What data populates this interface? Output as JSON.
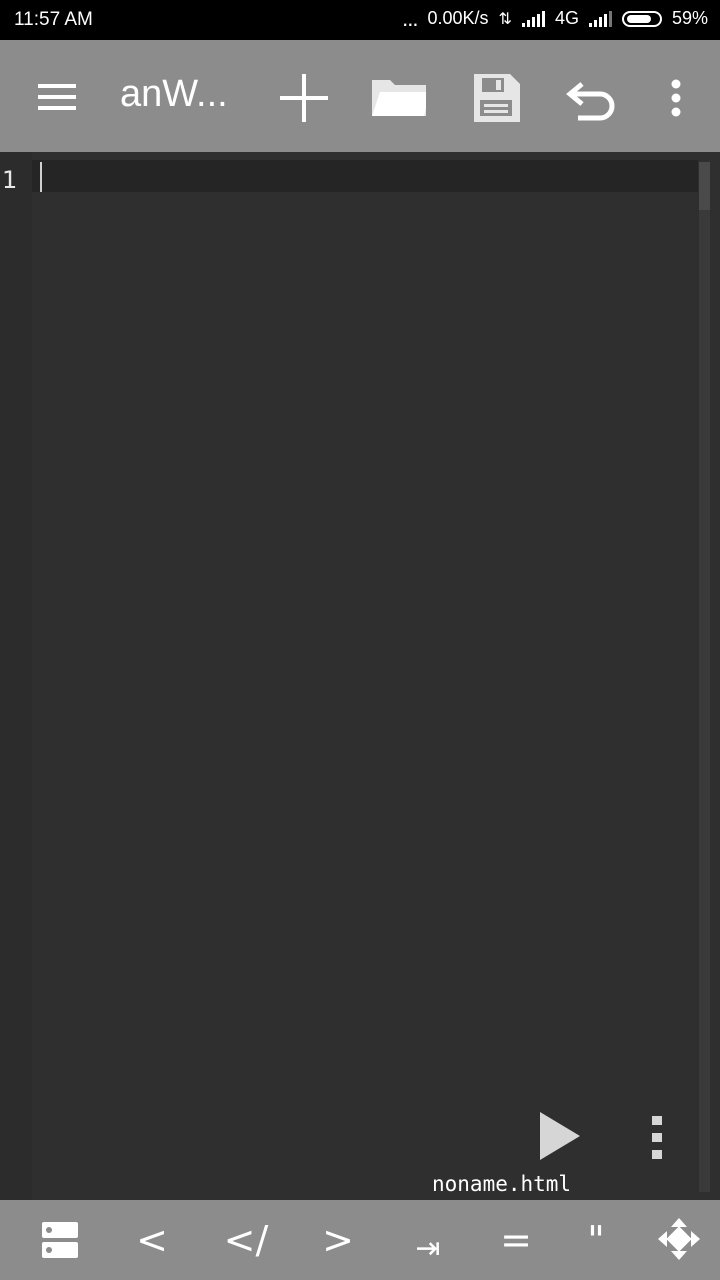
{
  "status_bar": {
    "time": "11:57 AM",
    "dots": "...",
    "speed": "0.00K/s",
    "network": "4G",
    "battery": "59%"
  },
  "toolbar": {
    "title": "anW...",
    "icons": [
      "menu-icon",
      "add-icon",
      "folder-icon",
      "save-icon",
      "undo-icon",
      "more-vert-icon"
    ]
  },
  "editor": {
    "line_numbers": [
      "1"
    ],
    "filename": "noname.html"
  },
  "bottom_bar": {
    "keys": [
      "<",
      "</",
      ">",
      "⇥",
      "=",
      "\""
    ],
    "icons": [
      "storage-icon",
      "move-icon"
    ]
  },
  "colors": {
    "toolbar_bg": "#8c8c8c",
    "editor_bg": "#2f2f2f",
    "status_bg": "#000000"
  }
}
